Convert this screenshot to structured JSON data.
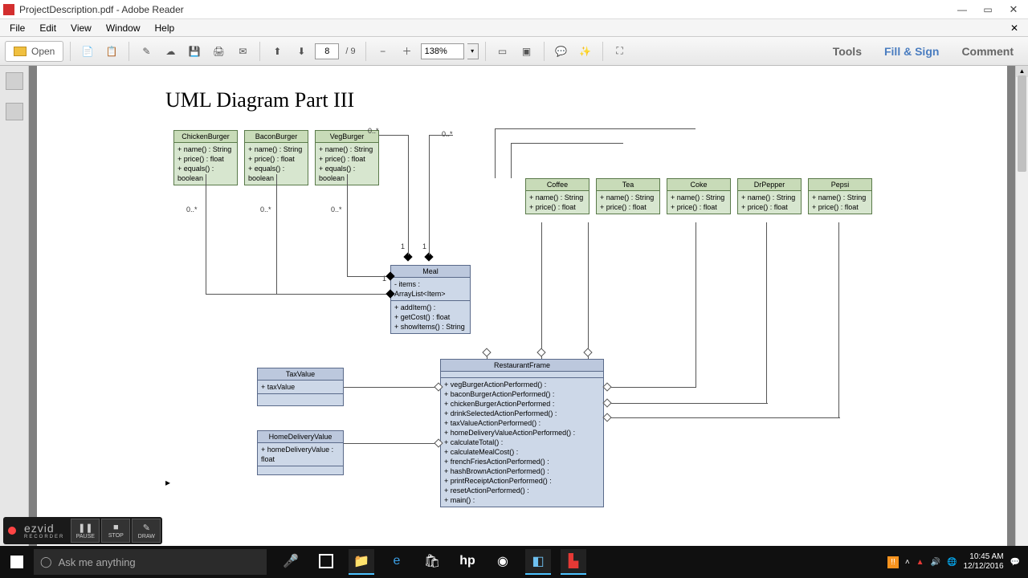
{
  "window": {
    "title": "ProjectDescription.pdf - Adobe Reader"
  },
  "menu": {
    "file": "File",
    "edit": "Edit",
    "view": "View",
    "window": "Window",
    "help": "Help"
  },
  "toolbar": {
    "open": "Open",
    "page_current": "8",
    "page_sep": "/ 9",
    "zoom": "138%",
    "tools": "Tools",
    "fillsign": "Fill & Sign",
    "comment": "Comment"
  },
  "doc": {
    "heading": "UML Diagram Part III",
    "classes": {
      "chicken": {
        "name": "ChickenBurger",
        "m1": "+ name() : String",
        "m2": "+ price() : float",
        "m3": "+ equals() : boolean"
      },
      "bacon": {
        "name": "BaconBurger",
        "m1": "+ name() : String",
        "m2": "+ price() : float",
        "m3": "+ equals() : boolean"
      },
      "veg": {
        "name": "VegBurger",
        "m1": "+ name() : String",
        "m2": "+ price() : float",
        "m3": "+ equals() : boolean"
      },
      "coffee": {
        "name": "Coffee",
        "m1": "+ name() : String",
        "m2": "+ price() : float"
      },
      "tea": {
        "name": "Tea",
        "m1": "+ name() : String",
        "m2": "+ price() : float"
      },
      "coke": {
        "name": "Coke",
        "m1": "+ name() : String",
        "m2": "+ price() : float"
      },
      "drpepper": {
        "name": "DrPepper",
        "m1": "+ name() : String",
        "m2": "+ price() : float"
      },
      "pepsi": {
        "name": "Pepsi",
        "m1": "+ name() : String",
        "m2": "+ price() : float"
      },
      "meal": {
        "name": "Meal",
        "a1": "- items : ArrayList<Item>",
        "m1": "+ addItem() :",
        "m2": "+ getCost() : float",
        "m3": "+ showItems() : String"
      },
      "tax": {
        "name": "TaxValue",
        "a1": "+ taxValue"
      },
      "home": {
        "name": "HomeDeliveryValue",
        "a1": "+ homeDeliveryValue : float"
      },
      "frame": {
        "name": "RestaurantFrame",
        "m1": "+ vegBurgerActionPerformed() :",
        "m2": "+ baconBurgerActionPerformed() :",
        "m3": "+ chickenBurgerActionPerformed :",
        "m4": "+ drinkSelectedActionPerformed() :",
        "m5": "+ taxValueActionPerformed() :",
        "m6": "+ homeDeliveryValueActionPerformed() :",
        "m7": "+ calculateTotal() :",
        "m8": "+ calculateMealCost() :",
        "m9": "+ frenchFriesActionPerformed() :",
        "m10": "+ hashBrownActionPerformed() :",
        "m11": "+ printReceiptActionPerformed() :",
        "m12": "+ resetActionPerformed() :",
        "m13": "+ main() :"
      }
    },
    "mult": {
      "zeroStarA": "0..*",
      "zeroStarB": "0..*",
      "zeroStarC": "0..*",
      "zeroStarD": "0..*",
      "zeroStarE": "0..*",
      "one1": "1",
      "one2": "1",
      "one3": "1"
    }
  },
  "recorder": {
    "brand": "ezvid",
    "sub": "RECORDER",
    "pause": "PAUSE",
    "stop": "STOP",
    "draw": "DRAW"
  },
  "taskbar": {
    "search_placeholder": "Ask me anything",
    "time": "10:45 AM",
    "date": "12/12/2016"
  }
}
